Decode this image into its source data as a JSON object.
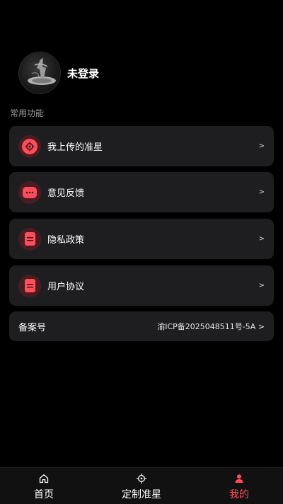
{
  "profile": {
    "username": "未登录"
  },
  "section": {
    "title": "常用功能"
  },
  "menu": [
    {
      "label": "我上传的准星",
      "icon": "crosshair-upload-icon",
      "chevron": ">"
    },
    {
      "label": "意见反馈",
      "icon": "chat-bubble-icon",
      "chevron": ">"
    },
    {
      "label": "隐私政策",
      "icon": "document-icon",
      "chevron": ">"
    },
    {
      "label": "用户协议",
      "icon": "document-icon",
      "chevron": ">"
    }
  ],
  "record": {
    "label": "备案号",
    "value": "渝ICP备2025048511号-5A >"
  },
  "tabs": [
    {
      "label": "首页",
      "icon": "home-icon",
      "active": false
    },
    {
      "label": "定制准星",
      "icon": "crosshair-icon",
      "active": false
    },
    {
      "label": "我的",
      "icon": "user-icon",
      "active": true
    }
  ],
  "colors": {
    "accent": "#ff4d5a",
    "card_bg": "#1e1e20",
    "background": "#000000"
  }
}
